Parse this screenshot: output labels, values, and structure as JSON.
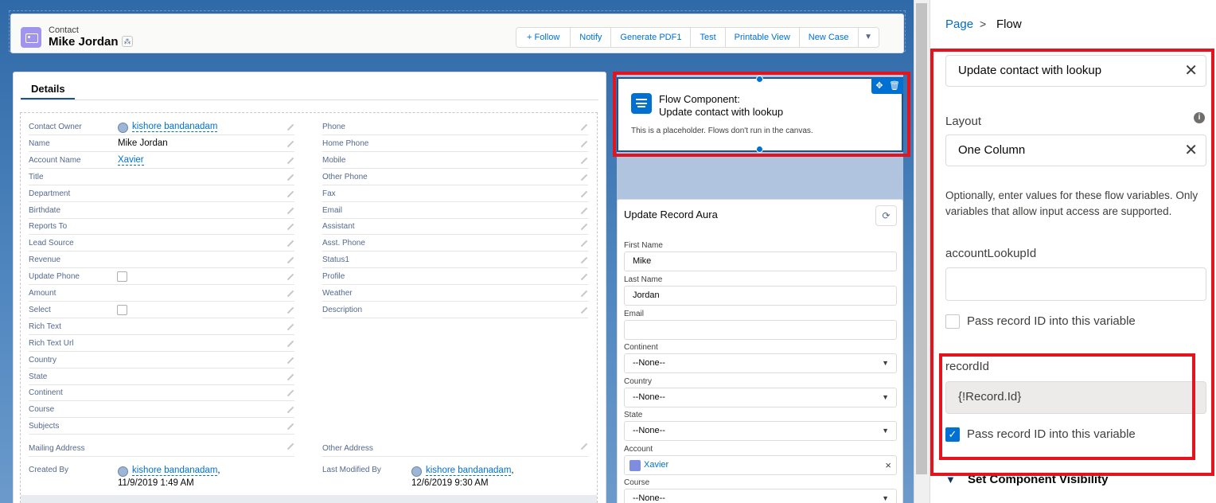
{
  "highlight": {
    "type": "Contact",
    "name": "Mike Jordan",
    "actions": [
      "Follow",
      "Notify",
      "Generate PDF1",
      "Test",
      "Printable View",
      "New Case"
    ],
    "follow_icon": "+"
  },
  "details": {
    "tab": "Details",
    "left_fields": [
      {
        "label": "Contact Owner",
        "value": "kishore bandanadam"
      },
      {
        "label": "Name",
        "value": "Mike Jordan"
      },
      {
        "label": "Account Name",
        "value": "Xavier"
      },
      {
        "label": "Title",
        "value": ""
      },
      {
        "label": "Department",
        "value": ""
      },
      {
        "label": "Birthdate",
        "value": ""
      },
      {
        "label": "Reports To",
        "value": ""
      },
      {
        "label": "Lead Source",
        "value": ""
      },
      {
        "label": "Revenue",
        "value": ""
      },
      {
        "label": "Update Phone",
        "value": ""
      },
      {
        "label": "Amount",
        "value": ""
      },
      {
        "label": "Select",
        "value": ""
      },
      {
        "label": "Rich Text",
        "value": ""
      },
      {
        "label": "Rich Text Url",
        "value": ""
      },
      {
        "label": "Country",
        "value": ""
      },
      {
        "label": "State",
        "value": ""
      },
      {
        "label": "Continent",
        "value": ""
      },
      {
        "label": "Course",
        "value": ""
      },
      {
        "label": "Subjects",
        "value": ""
      }
    ],
    "right_fields": [
      "Phone",
      "Home Phone",
      "Mobile",
      "Other Phone",
      "Fax",
      "Email",
      "Assistant",
      "Asst. Phone",
      "Status1",
      "Profile",
      "Weather",
      "Description"
    ],
    "mailing_address": "Mailing Address",
    "other_address": "Other Address",
    "created_by": {
      "label": "Created By",
      "user": "kishore bandanadam",
      "date": "11/9/2019 1:49 AM"
    },
    "modified_by": {
      "label": "Last Modified By",
      "user": "kishore bandanadam",
      "date": "12/6/2019 9:30 AM"
    }
  },
  "flow_component": {
    "title1": "Flow Component:",
    "title2": "Update contact with lookup",
    "note": "This is a placeholder. Flows don't run in the canvas."
  },
  "aura": {
    "title": "Update Record Aura",
    "fields": [
      {
        "label": "First Name",
        "value": "Mike"
      },
      {
        "label": "Last Name",
        "value": "Jordan"
      },
      {
        "label": "Email",
        "value": ""
      },
      {
        "label": "Continent",
        "value": "--None--"
      },
      {
        "label": "Country",
        "value": "--None--"
      },
      {
        "label": "State",
        "value": "--None--"
      },
      {
        "label": "Account",
        "value": "Xavier"
      },
      {
        "label": "Course",
        "value": "--None--"
      }
    ]
  },
  "panel": {
    "breadcrumb": {
      "page": "Page",
      "sep": ">",
      "current": "Flow"
    },
    "flow_value": "Update contact with lookup",
    "layout_label": "Layout",
    "layout_value": "One Column",
    "help": "Optionally, enter values for these flow variables. Only variables that allow input access are supported.",
    "var1": {
      "label": "accountLookupId",
      "value": "",
      "checkbox": "Pass record ID into this variable"
    },
    "var2": {
      "label": "recordId",
      "value": "{!Record.Id}",
      "checkbox": "Pass record ID into this variable"
    },
    "visibility": "Set Component Visibility"
  },
  "colors": {
    "highlight_red": "#e3141e",
    "brand_blue": "#0070d2"
  }
}
